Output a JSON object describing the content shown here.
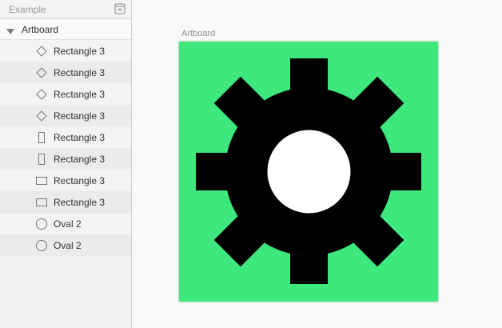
{
  "sidebar": {
    "document_title": "Example",
    "artboard_label": "Artboard",
    "layers": [
      {
        "label": "Rectangle 3",
        "icon": "diamond-icon"
      },
      {
        "label": "Rectangle 3",
        "icon": "diamond-icon"
      },
      {
        "label": "Rectangle 3",
        "icon": "diamond-icon"
      },
      {
        "label": "Rectangle 3",
        "icon": "diamond-icon"
      },
      {
        "label": "Rectangle 3",
        "icon": "vertical-rectangle-icon"
      },
      {
        "label": "Rectangle 3",
        "icon": "vertical-rectangle-icon"
      },
      {
        "label": "Rectangle 3",
        "icon": "horizontal-rectangle-icon"
      },
      {
        "label": "Rectangle 3",
        "icon": "horizontal-rectangle-icon"
      },
      {
        "label": "Oval 2",
        "icon": "oval-icon"
      },
      {
        "label": "Oval 2",
        "icon": "oval-icon"
      }
    ]
  },
  "canvas": {
    "artboard_caption": "Artboard"
  },
  "colors": {
    "artboard_background": "#3de87c",
    "gear": "#000000",
    "gear_hole": "#ffffff"
  }
}
